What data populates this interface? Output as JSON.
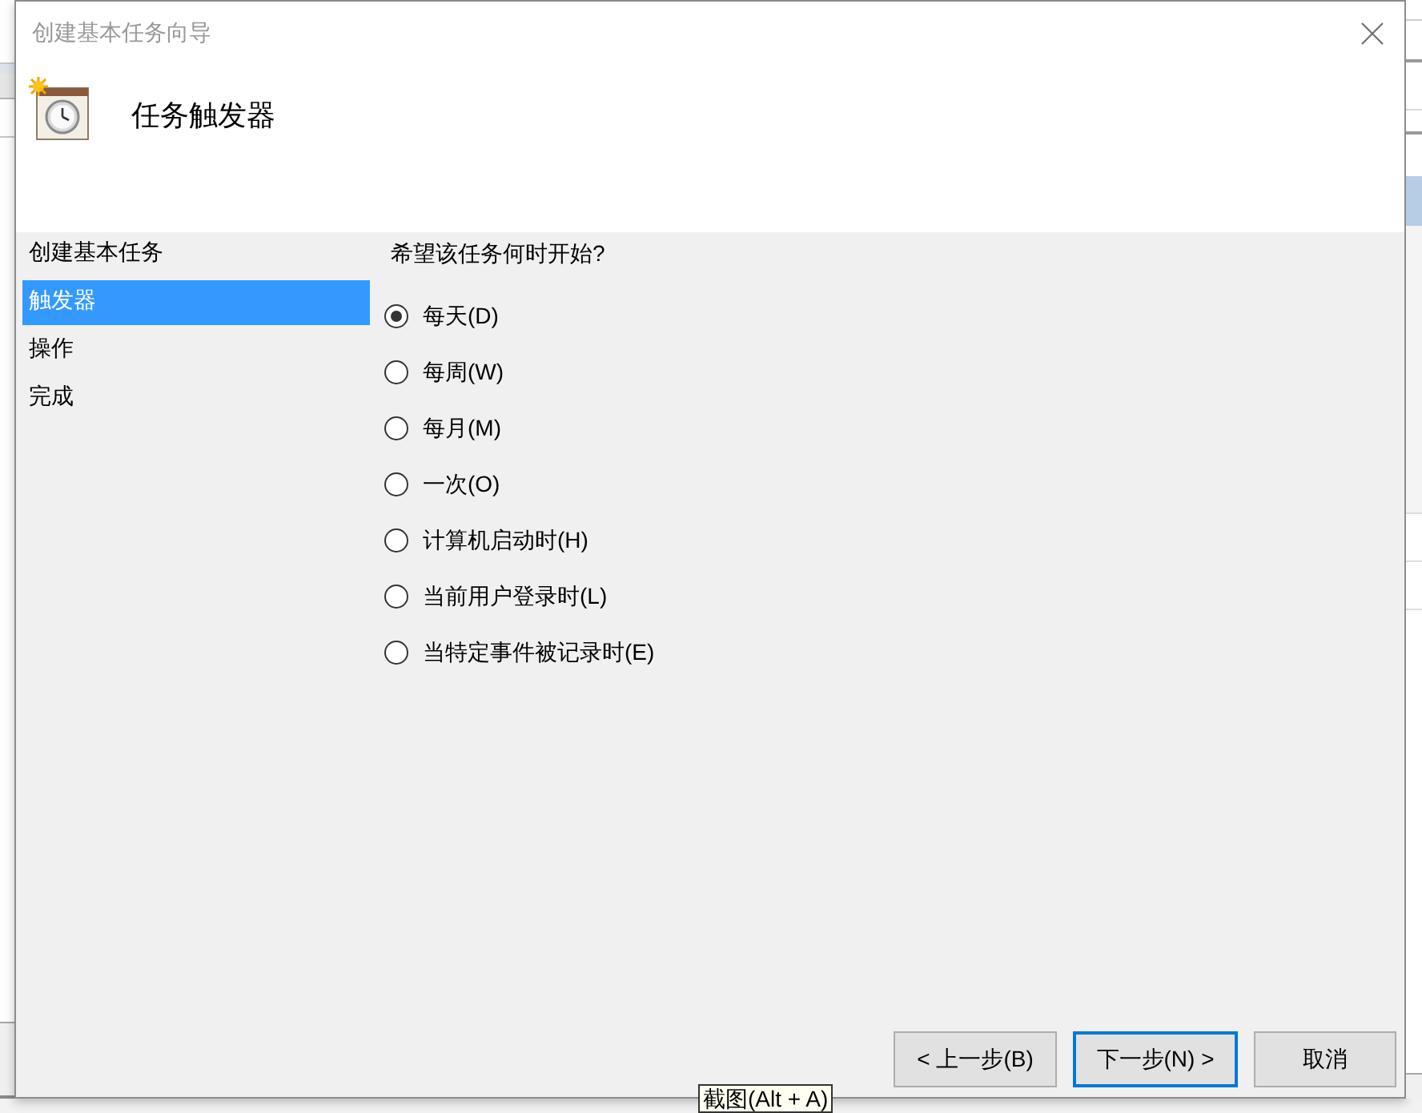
{
  "window": {
    "title": "创建基本任务向导"
  },
  "header": {
    "title": "任务触发器"
  },
  "steps": [
    {
      "label": "创建基本任务",
      "selected": false
    },
    {
      "label": "触发器",
      "selected": true
    },
    {
      "label": "操作",
      "selected": false
    },
    {
      "label": "完成",
      "selected": false
    }
  ],
  "question": "希望该任务何时开始?",
  "options": [
    {
      "label": "每天(D)",
      "selected": true
    },
    {
      "label": "每周(W)",
      "selected": false
    },
    {
      "label": "每月(M)",
      "selected": false
    },
    {
      "label": "一次(O)",
      "selected": false
    },
    {
      "label": "计算机启动时(H)",
      "selected": false
    },
    {
      "label": "当前用户登录时(L)",
      "selected": false
    },
    {
      "label": "当特定事件被记录时(E)",
      "selected": false
    }
  ],
  "buttons": [
    {
      "label": "< 上一步(B)",
      "default": false
    },
    {
      "label": "下一步(N) >",
      "default": true
    },
    {
      "label": "取消",
      "default": false
    }
  ],
  "tooltip": "截图(Alt + A)"
}
